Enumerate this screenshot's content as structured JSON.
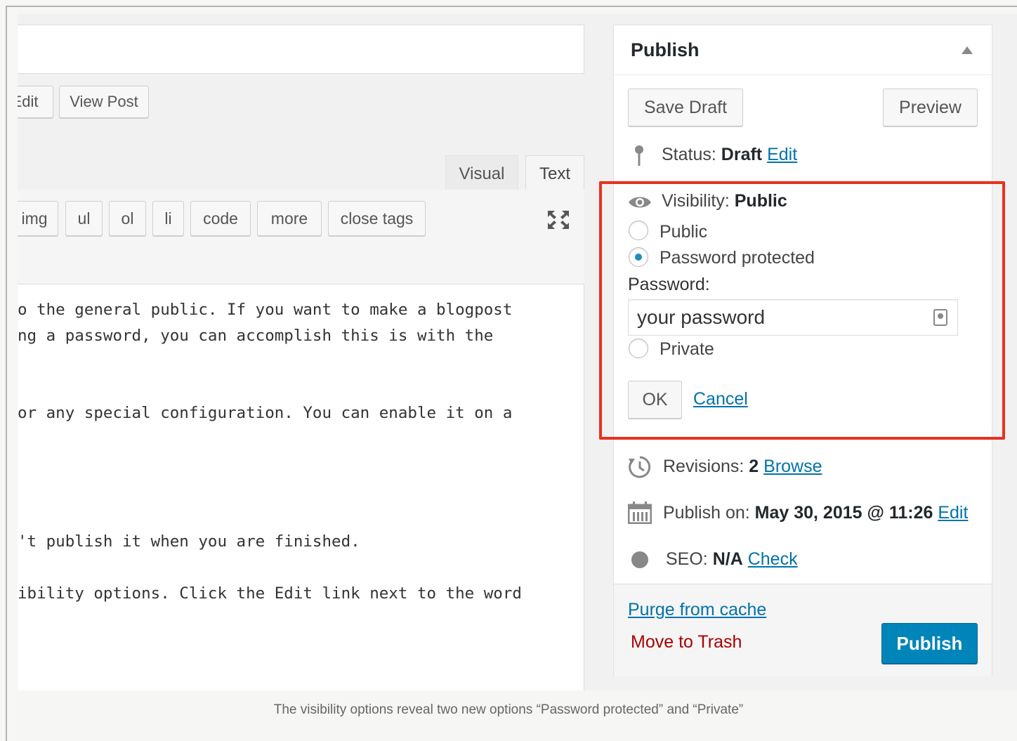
{
  "editor": {
    "buttons": {
      "edit": "Edit",
      "view_post": "View Post"
    },
    "tabs": {
      "visual": "Visual",
      "text": "Text"
    },
    "quicktags": [
      "img",
      "ul",
      "ol",
      "li",
      "code",
      "more",
      "close tags"
    ],
    "lines": [
      "o the general public. If you want to make a blogpost",
      "ng a password, you can accomplish this is with the",
      "or any special configuration. You can enable it on a",
      "'t publish it when you are finished.",
      "ibility options. Click the Edit link next to the word"
    ]
  },
  "publish": {
    "title": "Publish",
    "save_draft": "Save Draft",
    "preview": "Preview",
    "status_label": "Status:",
    "status_value": "Draft",
    "status_edit": "Edit",
    "visibility_label": "Visibility:",
    "visibility_value": "Public",
    "options": {
      "public": "Public",
      "password_protected": "Password protected",
      "private": "Private"
    },
    "selected_option": "password_protected",
    "password_label": "Password:",
    "password_value": "your password",
    "ok": "OK",
    "cancel": "Cancel",
    "revisions_label": "Revisions:",
    "revisions_count": "2",
    "revisions_browse": "Browse",
    "publish_on_label": "Publish on:",
    "publish_on_value": "May 30, 2015 @ 11:26",
    "publish_on_edit": "Edit",
    "seo_label": "SEO:",
    "seo_value": "N/A",
    "seo_check": "Check",
    "purge": "Purge from cache",
    "trash": "Move to Trash",
    "publish_button": "Publish"
  },
  "caption": "The visibility options reveal two new options “Password protected” and “Private”",
  "colors": {
    "highlight": "#e8311e",
    "link": "#0073aa",
    "primary": "#0085ba",
    "trash": "#a00"
  }
}
